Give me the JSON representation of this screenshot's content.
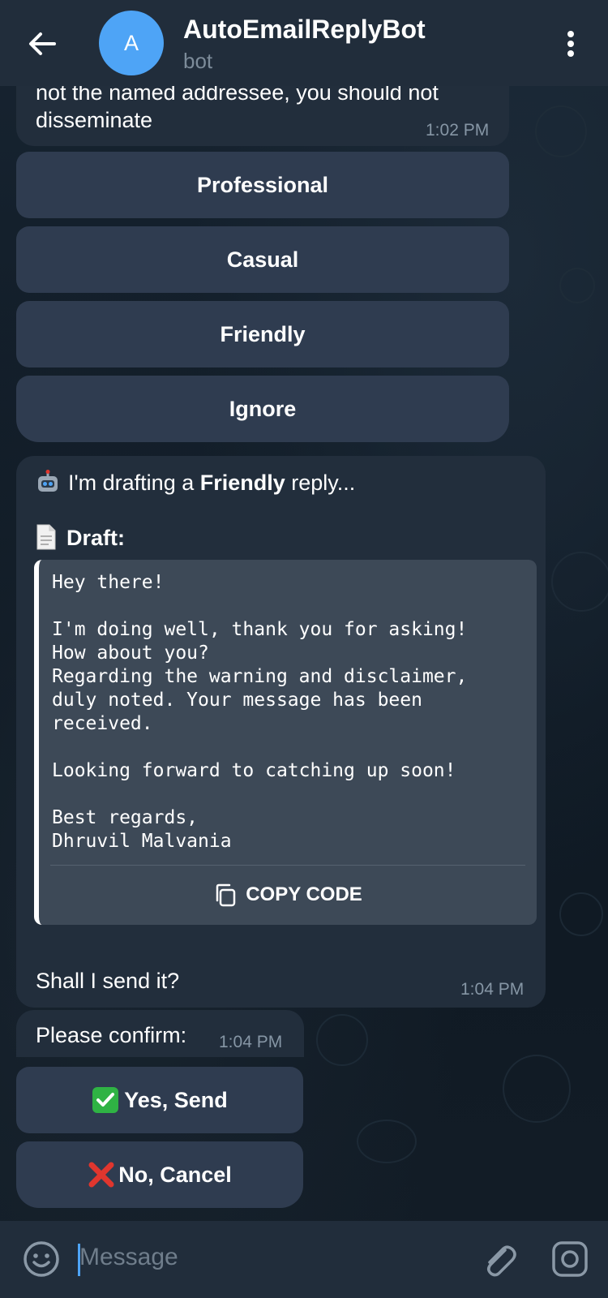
{
  "header": {
    "back_icon": "arrow-left-icon",
    "avatar_letter": "A",
    "avatar_color": "#4ea4f6",
    "title": "AutoEmailReplyBot",
    "subtitle": "bot",
    "menu_icon": "more-vertical-icon"
  },
  "messages": {
    "prev_message": {
      "text_line1": "not the named addressee, you should not",
      "text_line2": "disseminate",
      "time": "1:02 PM"
    },
    "tone_buttons": [
      "Professional",
      "Casual",
      "Friendly",
      "Ignore"
    ],
    "draft_message": {
      "intro_prefix": "I'm drafting a ",
      "intro_bold": "Friendly",
      "intro_suffix": " reply...",
      "draft_label": "Draft:",
      "code": "Hey there!\n\nI'm doing well, thank you for asking!\nHow about you?\nRegarding the warning and disclaimer,\nduly noted. Your message has been\nreceived.\n\nLooking forward to catching up soon!\n\nBest regards,\nDhruvil Malvania",
      "copy_label": "COPY CODE",
      "question": "Shall I send it?",
      "time": "1:04 PM"
    },
    "confirm_message": {
      "text": "Please confirm:",
      "time": "1:04 PM"
    },
    "confirm_buttons": {
      "yes_label": "Yes, Send",
      "no_label": "No, Cancel"
    }
  },
  "input": {
    "placeholder": "Message",
    "emoji_icon": "emoji-icon",
    "attach_icon": "paperclip-icon",
    "camera_icon": "camera-icon"
  },
  "colors": {
    "accent": "#4ea4f6",
    "bubble": "#222e3c",
    "keyboard_button": "#2f3c50",
    "yes_green": "#2fb344",
    "no_red": "#e0362e"
  }
}
